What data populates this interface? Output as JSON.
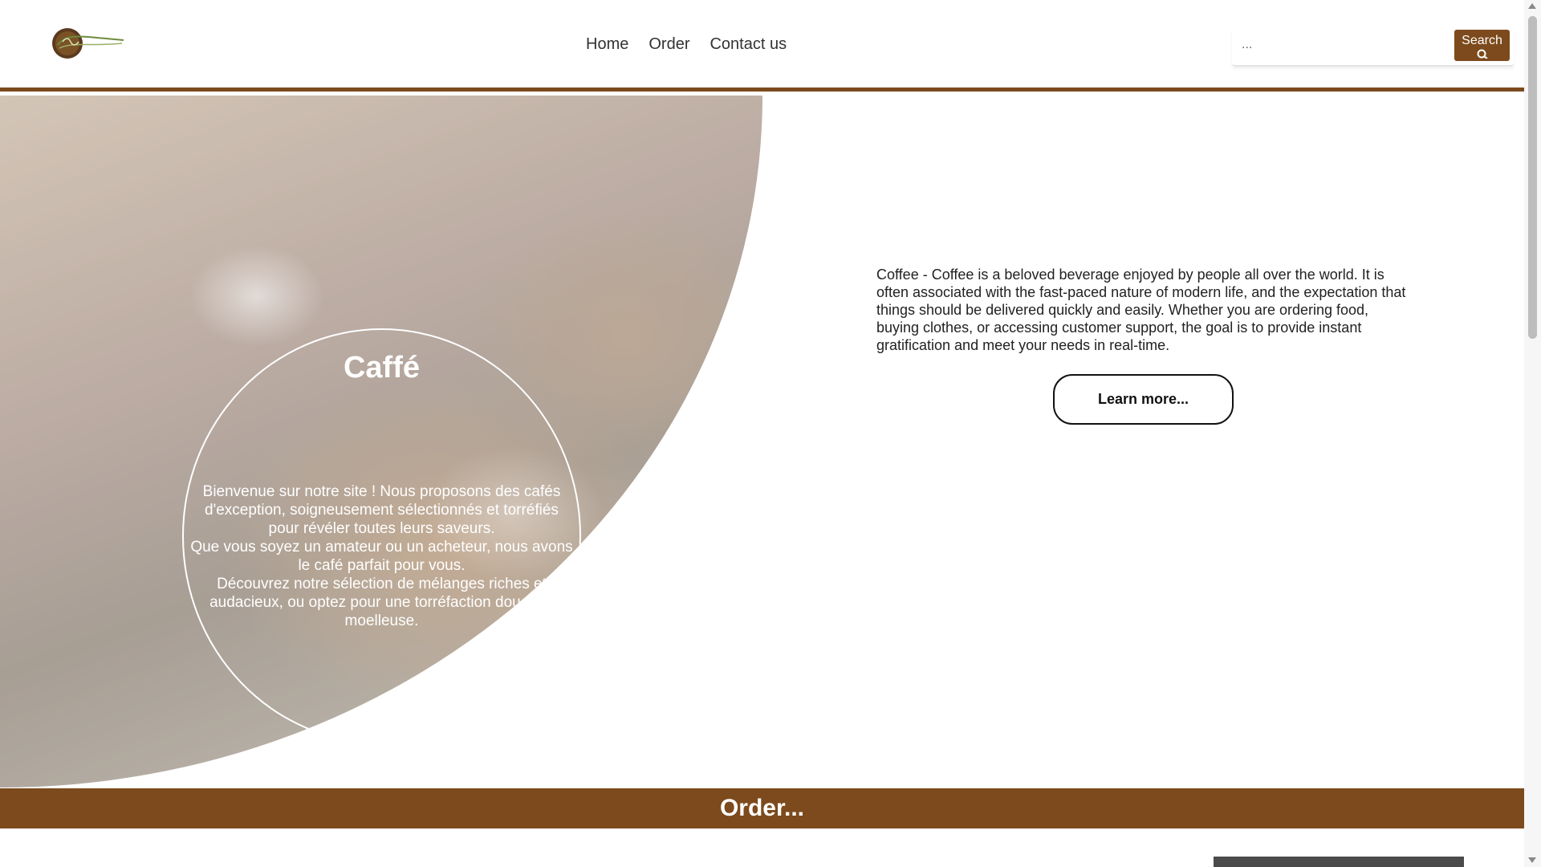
{
  "header": {
    "logo_alt": "caffé",
    "nav": [
      {
        "label": "Home"
      },
      {
        "label": "Order"
      },
      {
        "label": "Contact us"
      }
    ],
    "search": {
      "placeholder": "...",
      "button_label": "Search"
    }
  },
  "hero": {
    "title": "Caffé",
    "text_lines": [
      "Bienvenue sur notre site ! Nous proposons des cafés d'exception, soigneusement sélectionnés et torréfiés pour révéler toutes leurs saveurs.",
      "Que vous soyez un amateur ou un acheteur, nous avons le café parfait pour vous.",
      "Découvrez notre sélection de mélanges riches et audacieux, ou optez pour une torréfaction douce et moelleuse."
    ]
  },
  "intro": {
    "text": "Coffee - Coffee is a beloved beverage enjoyed by people all over the world. It is often associated with the fast-paced nature of modern life, and the expectation that things should be delivered quickly and easily. Whether you are ordering food, buying clothes, or accessing customer support, the goal is to provide instant gratification and meet your needs in real-time.",
    "button_label": "Learn more..."
  },
  "order": {
    "title": "Order..."
  },
  "colors": {
    "brand": "#7c4a1c",
    "white": "#ffffff"
  }
}
